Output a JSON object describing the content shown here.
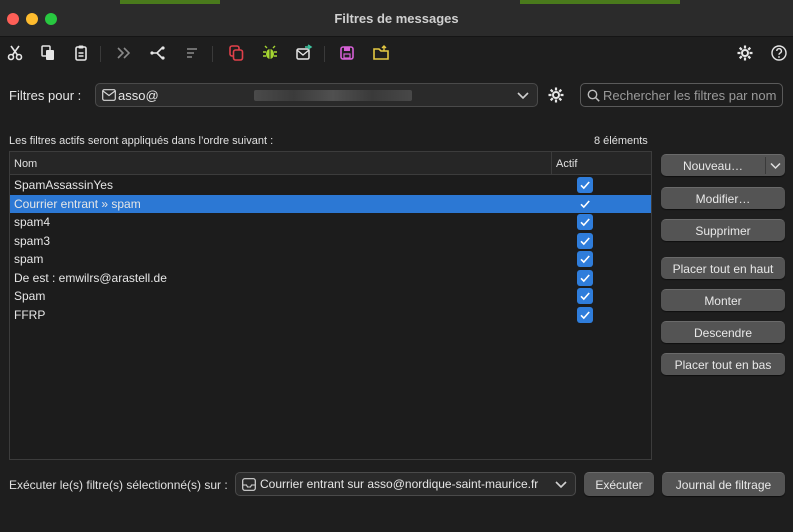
{
  "window": {
    "title": "Filtres de messages"
  },
  "toolbar": {
    "icons": [
      "cut-icon",
      "copy-icon",
      "paste-icon",
      "forward-icon",
      "fork-icon",
      "list-icon",
      "duplicate-icon",
      "bug-icon",
      "mail-send-icon",
      "save-icon",
      "folder-icon",
      "gear-icon",
      "help-icon"
    ]
  },
  "account": {
    "label": "Filtres pour :",
    "selected": "asso@",
    "search_placeholder": "Rechercher les filtres par nom"
  },
  "list": {
    "order_text": "Les filtres actifs seront appliqués dans l’ordre suivant :",
    "count_text": "8 éléments",
    "col_name": "Nom",
    "col_active": "Actif",
    "rows": [
      {
        "name": "SpamAssassinYes",
        "active": true,
        "selected": false
      },
      {
        "name": "Courrier entrant » spam",
        "active": true,
        "selected": true
      },
      {
        "name": "spam4",
        "active": true,
        "selected": false
      },
      {
        "name": "spam3",
        "active": true,
        "selected": false
      },
      {
        "name": "spam",
        "active": true,
        "selected": false
      },
      {
        "name": "De est : emwilrs@arastell.de",
        "active": true,
        "selected": false
      },
      {
        "name": "Spam",
        "active": true,
        "selected": false
      },
      {
        "name": "FFRP",
        "active": true,
        "selected": false
      }
    ]
  },
  "buttons": {
    "new": "Nouveau…",
    "edit": "Modifier…",
    "delete": "Supprimer",
    "move_top": "Placer tout en haut",
    "move_up": "Monter",
    "move_down": "Descendre",
    "move_bottom": "Placer tout en bas",
    "run": "Exécuter",
    "log": "Journal de filtrage"
  },
  "bottom": {
    "label": "Exécuter le(s) filtre(s) sélectionné(s) sur :",
    "run_on": "Courrier entrant sur asso@nordique-saint-maurice.fr"
  },
  "colors": {
    "selection": "#2c78d4",
    "checkbox": "#2f7ddb",
    "background": "#1e1e1e",
    "button": "#545454"
  }
}
